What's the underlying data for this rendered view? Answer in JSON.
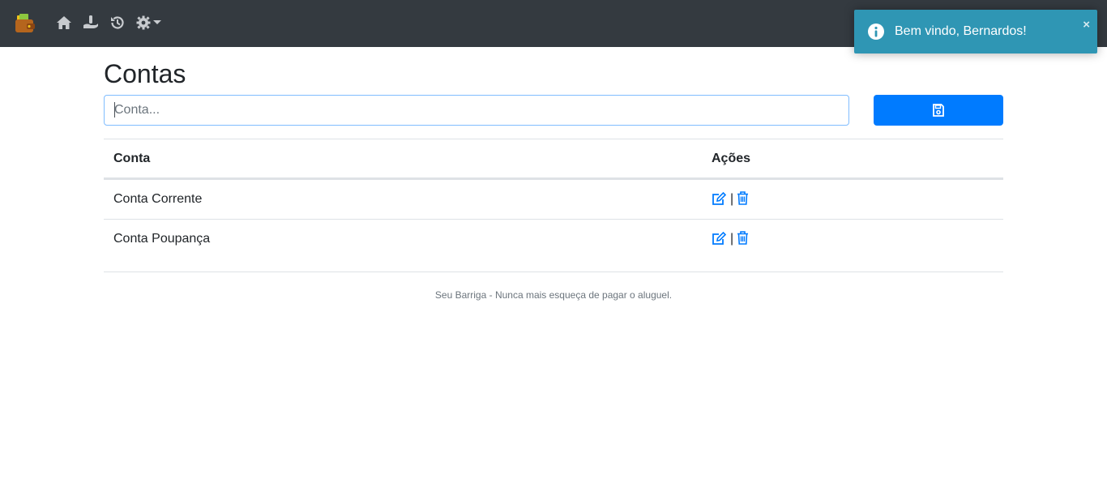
{
  "navbar": {
    "background": "#343a40",
    "icons": [
      "wallet-icon",
      "home-icon",
      "hand-money-icon",
      "history-icon",
      "gear-icon",
      "caret-down-icon"
    ]
  },
  "toast": {
    "message": "Bem vindo, Bernardos!",
    "close_label": "×",
    "color": "#2f96b4"
  },
  "page": {
    "title": "Contas"
  },
  "form": {
    "input_value": "",
    "input_placeholder": "Conta...",
    "save_icon": "save-icon",
    "button_color": "#007bff"
  },
  "table": {
    "headers": [
      "Conta",
      "Ações"
    ],
    "rows": [
      {
        "conta": "Conta Corrente",
        "separator": "|"
      },
      {
        "conta": "Conta Poupança",
        "separator": "|"
      }
    ],
    "action_icons": [
      "edit-icon",
      "trash-icon"
    ],
    "action_color": "#007bff"
  },
  "footer": {
    "text": "Seu Barriga - Nunca mais esqueça de pagar o aluguel."
  }
}
